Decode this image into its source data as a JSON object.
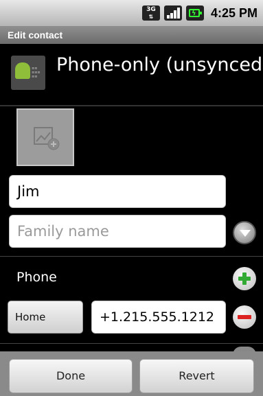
{
  "status_bar": {
    "network": "3G",
    "time": "4:25 PM",
    "icons": [
      "3g-data-icon",
      "signal-strength-icon",
      "battery-charging-icon"
    ]
  },
  "title_bar": {
    "title": "Edit contact"
  },
  "account": {
    "name": "Phone-only (unsynced..",
    "icon": "android-account-icon"
  },
  "photo": {
    "icon": "add-photo-icon"
  },
  "name_fields": {
    "given_name_value": "Jim",
    "family_name_placeholder": "Family name",
    "expand_icon": "chevron-down-icon"
  },
  "phone_section": {
    "label": "Phone",
    "add_icon": "plus-icon",
    "type_label": "Home",
    "number_value": "+1.215.555.1212",
    "remove_icon": "minus-icon"
  },
  "actions": {
    "done_label": "Done",
    "revert_label": "Revert"
  },
  "colors": {
    "add_green": "#33aa33",
    "remove_red": "#dd2222",
    "android_green": "#8fbf3a"
  }
}
